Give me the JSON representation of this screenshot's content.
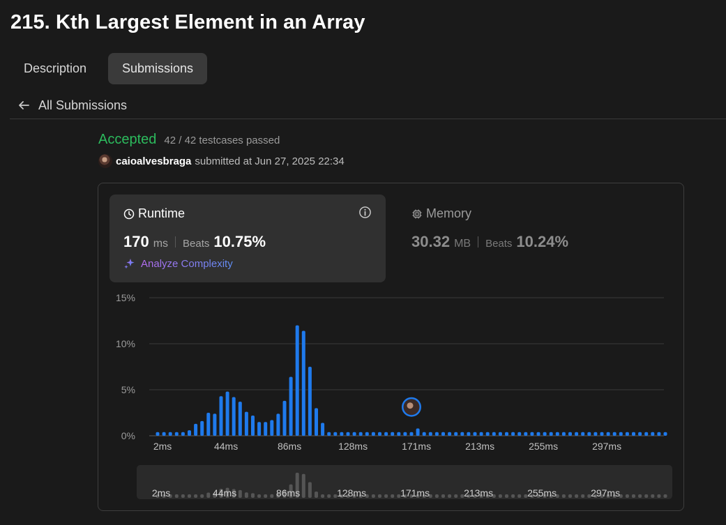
{
  "problem": {
    "title": "215. Kth Largest Element in an Array"
  },
  "tabs": [
    {
      "label": "Description",
      "active": false
    },
    {
      "label": "Submissions",
      "active": true
    }
  ],
  "back_link": {
    "label": "All Submissions"
  },
  "submission": {
    "status": "Accepted",
    "testcases": "42 / 42 testcases passed",
    "username": "caioalvesbraga",
    "submitted_text": "submitted at Jun 27, 2025 22:34"
  },
  "runtime": {
    "label": "Runtime",
    "value": "170",
    "unit": "ms",
    "beats_label": "Beats",
    "beats_value": "10.75%",
    "analyze_label": "Analyze Complexity"
  },
  "memory": {
    "label": "Memory",
    "value": "30.32",
    "unit": "MB",
    "beats_label": "Beats",
    "beats_value": "10.24%"
  },
  "colors": {
    "accepted": "#2cbb5d",
    "bar": "#1f7aec",
    "bar_mini": "#555555"
  },
  "chart_data": {
    "type": "bar",
    "y_ticks": [
      "15%",
      "10%",
      "5%",
      "0%"
    ],
    "ylim": [
      0,
      15
    ],
    "x_ticks": [
      "2ms",
      "44ms",
      "86ms",
      "128ms",
      "171ms",
      "213ms",
      "255ms",
      "297ms"
    ],
    "x_tick_indices": [
      1,
      11,
      21,
      31,
      41,
      51,
      61,
      71
    ],
    "highlight_index": 40,
    "highlight_label": "170ms",
    "values": [
      0.4,
      0.4,
      0.4,
      0.4,
      0.4,
      0.6,
      1.3,
      1.6,
      2.5,
      2.4,
      4.3,
      4.8,
      4.2,
      3.7,
      2.6,
      2.2,
      1.5,
      1.5,
      1.7,
      2.4,
      3.8,
      6.4,
      12.0,
      11.4,
      7.5,
      3.0,
      1.4,
      0.4,
      0.4,
      0.4,
      0.4,
      0.4,
      0.4,
      0.4,
      0.4,
      0.4,
      0.4,
      0.4,
      0.4,
      0.4,
      0.4,
      0.8,
      0.4,
      0.4,
      0.4,
      0.4,
      0.4,
      0.4,
      0.4,
      0.4,
      0.4,
      0.4,
      0.4,
      0.4,
      0.4,
      0.4,
      0.4,
      0.4,
      0.4,
      0.4,
      0.4,
      0.4,
      0.4,
      0.4,
      0.4,
      0.4,
      0.4,
      0.4,
      0.4,
      0.4,
      0.4,
      0.4,
      0.4,
      0.4,
      0.4,
      0.4,
      0.4,
      0.4,
      0.4,
      0.4,
      0.4
    ]
  }
}
